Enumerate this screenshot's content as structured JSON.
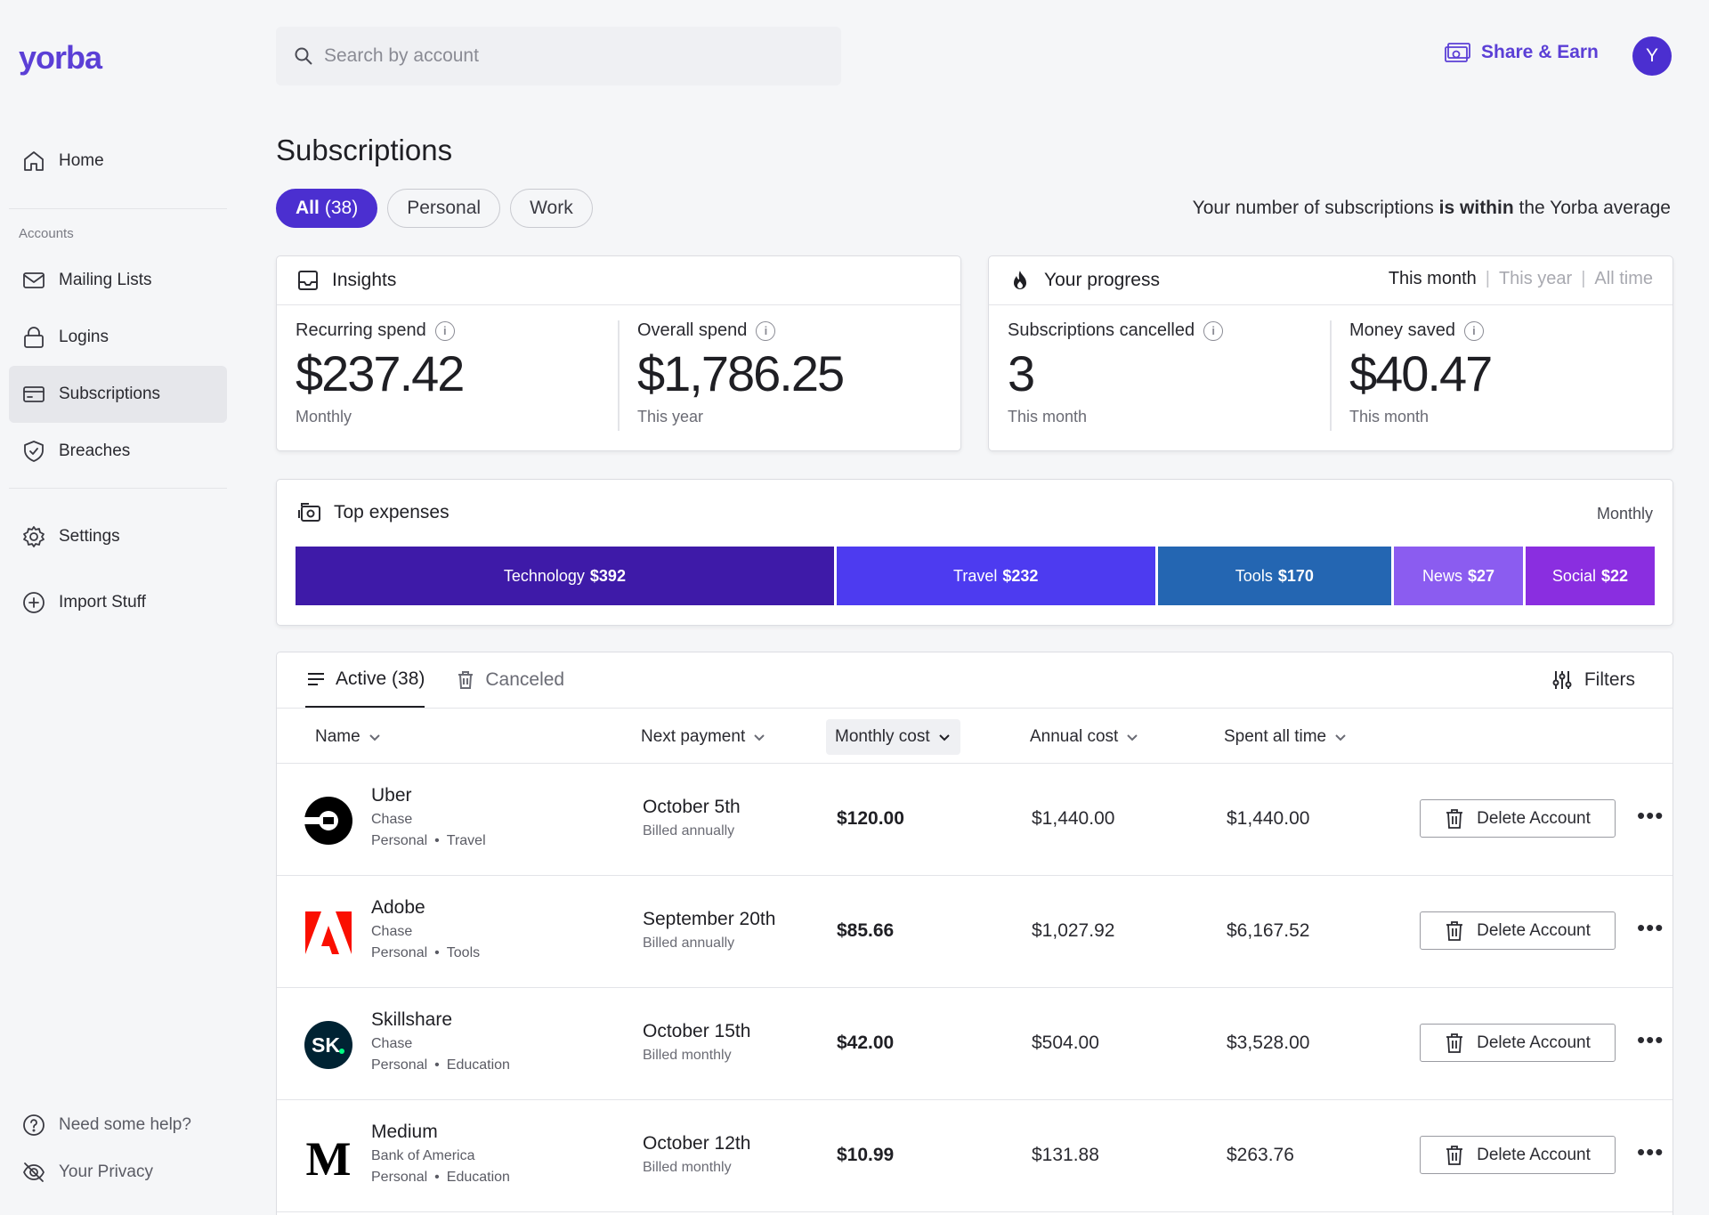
{
  "brand": {
    "logo": "yorba",
    "accent": "#5b3fd6"
  },
  "sidebar": {
    "home": "Home",
    "section_label": "Accounts",
    "items": [
      {
        "label": "Mailing Lists",
        "icon": "mail-icon"
      },
      {
        "label": "Logins",
        "icon": "lock-icon"
      },
      {
        "label": "Subscriptions",
        "icon": "card-icon",
        "active": true
      },
      {
        "label": "Breaches",
        "icon": "shield-icon"
      }
    ],
    "settings": "Settings",
    "import": "Import Stuff",
    "help": "Need some help?",
    "privacy": "Your Privacy"
  },
  "header": {
    "search_placeholder": "Search by account",
    "share_label": "Share & Earn",
    "avatar_initial": "Y"
  },
  "page": {
    "title": "Subscriptions",
    "filters": [
      {
        "label": "All",
        "count": "(38)",
        "active": true
      },
      {
        "label": "Personal"
      },
      {
        "label": "Work"
      }
    ],
    "avg_note_pre": "Your number of subscriptions ",
    "avg_note_bold": "is within",
    "avg_note_post": " the Yorba average"
  },
  "insights": {
    "title": "Insights",
    "recurring_label": "Recurring spend",
    "recurring_value": "$237.42",
    "recurring_sub": "Monthly",
    "overall_label": "Overall spend",
    "overall_value": "$1,786.25",
    "overall_sub": "This year"
  },
  "progress": {
    "title": "Your progress",
    "periods": [
      "This month",
      "This year",
      "All time"
    ],
    "cancelled_label": "Subscriptions cancelled",
    "cancelled_value": "3",
    "cancelled_sub": "This month",
    "saved_label": "Money saved",
    "saved_value": "$40.47",
    "saved_sub": "This month"
  },
  "top_expenses": {
    "title": "Top expenses",
    "period": "Monthly",
    "categories": [
      {
        "name": "Technology",
        "amount": "$392",
        "value": 392,
        "color": "#3e1aa8"
      },
      {
        "name": "Travel",
        "amount": "$232",
        "value": 232,
        "color": "#4d3bf0"
      },
      {
        "name": "Tools",
        "amount": "$170",
        "value": 170,
        "color": "#2466b2"
      },
      {
        "name": "News",
        "amount": "$27",
        "value": 27,
        "color": "#8b5cf0"
      },
      {
        "name": "Social",
        "amount": "$22",
        "value": 22,
        "color": "#8a2ee0"
      }
    ]
  },
  "table": {
    "tab_active": "Active (38)",
    "tab_canceled": "Canceled",
    "filters_label": "Filters",
    "columns": {
      "name": "Name",
      "next_payment": "Next payment",
      "monthly": "Monthly cost",
      "annual": "Annual cost",
      "spent": "Spent all time"
    },
    "delete_label": "Delete Account",
    "rows": [
      {
        "name": "Uber",
        "bank": "Chase",
        "tag1": "Personal",
        "tag2": "Travel",
        "next": "October 5th",
        "billing": "Billed annually",
        "monthly": "$120.00",
        "annual": "$1,440.00",
        "spent": "$1,440.00",
        "logo": "uber-logo"
      },
      {
        "name": "Adobe",
        "bank": "Chase",
        "tag1": "Personal",
        "tag2": "Tools",
        "next": "September 20th",
        "billing": "Billed annually",
        "monthly": "$85.66",
        "annual": "$1,027.92",
        "spent": "$6,167.52",
        "logo": "adobe-logo"
      },
      {
        "name": "Skillshare",
        "bank": "Chase",
        "tag1": "Personal",
        "tag2": "Education",
        "next": "October 15th",
        "billing": "Billed monthly",
        "monthly": "$42.00",
        "annual": "$504.00",
        "spent": "$3,528.00",
        "logo": "skillshare-logo",
        "logo_text": "SK"
      },
      {
        "name": "Medium",
        "bank": "Bank of America",
        "tag1": "Personal",
        "tag2": "Education",
        "next": "October 12th",
        "billing": "Billed monthly",
        "monthly": "$10.99",
        "annual": "$131.88",
        "spent": "$263.76",
        "logo": "medium-logo",
        "logo_text": "M"
      }
    ]
  }
}
